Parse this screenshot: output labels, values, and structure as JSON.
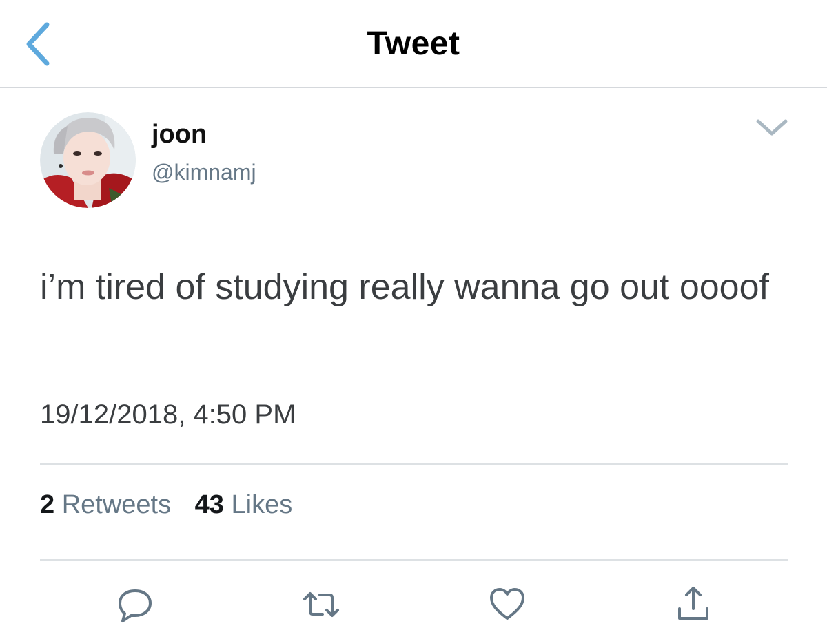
{
  "navbar": {
    "title": "Tweet",
    "back_icon": "chevron-left-icon",
    "accent_color": "#5ea9dd"
  },
  "author": {
    "display_name": "joon",
    "handle": "@kimnamj"
  },
  "tweet": {
    "text": "i’m tired of studying really wanna go out oooof",
    "timestamp": "19/12/2018, 4:50 PM"
  },
  "stats": {
    "retweets_count": "2",
    "retweets_label": "Retweets",
    "likes_count": "43",
    "likes_label": "Likes"
  },
  "actions": [
    {
      "icon": "reply-icon"
    },
    {
      "icon": "retweet-icon"
    },
    {
      "icon": "like-icon"
    },
    {
      "icon": "share-icon"
    }
  ],
  "colors": {
    "secondary_text": "#657786",
    "icon_gray": "#657786",
    "divider": "#dde1e4"
  }
}
